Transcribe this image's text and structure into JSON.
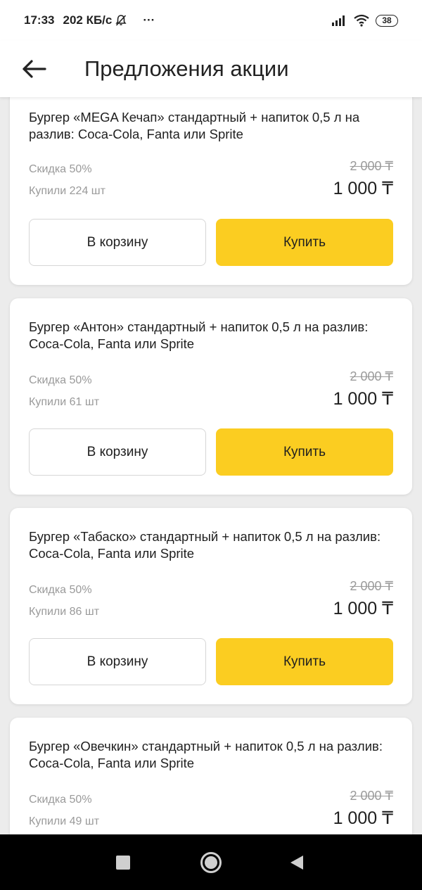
{
  "status_bar": {
    "time": "17:33",
    "speed": "202 КБ/с",
    "more": "···",
    "battery": "38"
  },
  "header": {
    "title": "Предложения акции"
  },
  "offers": [
    {
      "title": "Бургер «MEGA Кечап» стандартный + напиток 0,5 л на разлив: Coca-Cola, Fanta или Sprite",
      "discount": "Скидка 50%",
      "bought": "Купили 224 шт",
      "old_price": "2 000 ₸",
      "new_price": "1 000 ₸",
      "cart_label": "В корзину",
      "buy_label": "Купить"
    },
    {
      "title": "Бургер «Антон» стандартный + напиток 0,5 л на разлив: Coca-Cola, Fanta или Sprite",
      "discount": "Скидка 50%",
      "bought": "Купили 61 шт",
      "old_price": "2 000 ₸",
      "new_price": "1 000 ₸",
      "cart_label": "В корзину",
      "buy_label": "Купить"
    },
    {
      "title": "Бургер «Табаско» стандартный + напиток 0,5 л на разлив: Coca-Cola, Fanta или Sprite",
      "discount": "Скидка 50%",
      "bought": "Купили 86 шт",
      "old_price": "2 000 ₸",
      "new_price": "1 000 ₸",
      "cart_label": "В корзину",
      "buy_label": "Купить"
    },
    {
      "title": "Бургер «Овечкин» стандартный + напиток 0,5 л на разлив: Coca-Cola, Fanta или Sprite",
      "discount": "Скидка 50%",
      "bought": "Купили 49 шт",
      "old_price": "2 000 ₸",
      "new_price": "1 000 ₸"
    }
  ],
  "icons": {
    "back": "arrow-left-icon",
    "signal": "signal-icon",
    "wifi": "wifi-icon",
    "mute": "bell-off-icon",
    "nav_recent": "square-icon",
    "nav_home": "circle-icon",
    "nav_back": "triangle-left-icon"
  },
  "colors": {
    "accent": "#fbcd21",
    "background": "#ececec",
    "muted_text": "#9a9a9a"
  }
}
